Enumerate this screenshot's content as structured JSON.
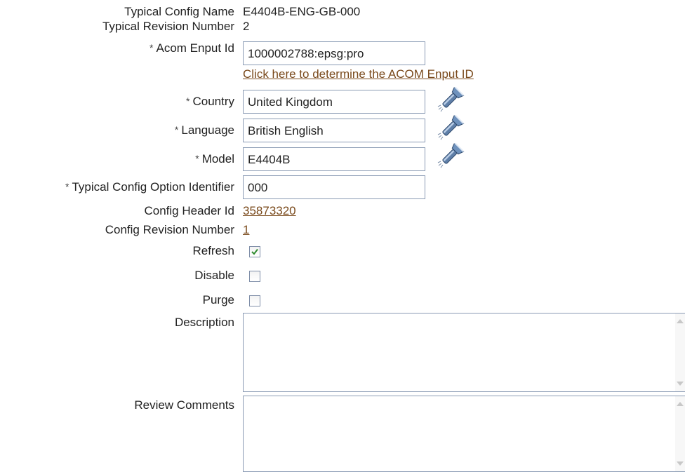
{
  "form": {
    "typical_config_name": {
      "label": "Typical Config Name",
      "value": "E4404B-ENG-GB-000"
    },
    "typical_revision_number": {
      "label": "Typical Revision Number",
      "value": "2"
    },
    "acom_enput_id": {
      "label": "Acom Enput Id",
      "required_marker": "*",
      "value": "1000002788:epsg:pro",
      "help_link": "Click here to determine the ACOM Enput ID"
    },
    "country": {
      "label": "Country",
      "required_marker": "*",
      "value": "United Kingdom",
      "lov_icon": "flashlight-search-icon"
    },
    "language": {
      "label": "Language",
      "required_marker": "*",
      "value": "British English",
      "lov_icon": "flashlight-search-icon"
    },
    "model": {
      "label": "Model",
      "required_marker": "*",
      "value": "E4404B",
      "lov_icon": "flashlight-search-icon"
    },
    "typical_config_option_identifier": {
      "label": "Typical Config Option Identifier",
      "required_marker": "*",
      "value": "000"
    },
    "config_header_id": {
      "label": "Config Header Id",
      "value": "35873320"
    },
    "config_revision_number": {
      "label": "Config Revision Number",
      "value": "1"
    },
    "refresh": {
      "label": "Refresh",
      "checked": true
    },
    "disable": {
      "label": "Disable",
      "checked": false
    },
    "purge": {
      "label": "Purge",
      "checked": false
    },
    "description": {
      "label": "Description",
      "value": ""
    },
    "review_comments": {
      "label": "Review Comments",
      "value": ""
    }
  },
  "colors": {
    "link": "#7a4a1c",
    "field_border": "#8a9bb4",
    "checkmark": "#2e8b2e"
  }
}
